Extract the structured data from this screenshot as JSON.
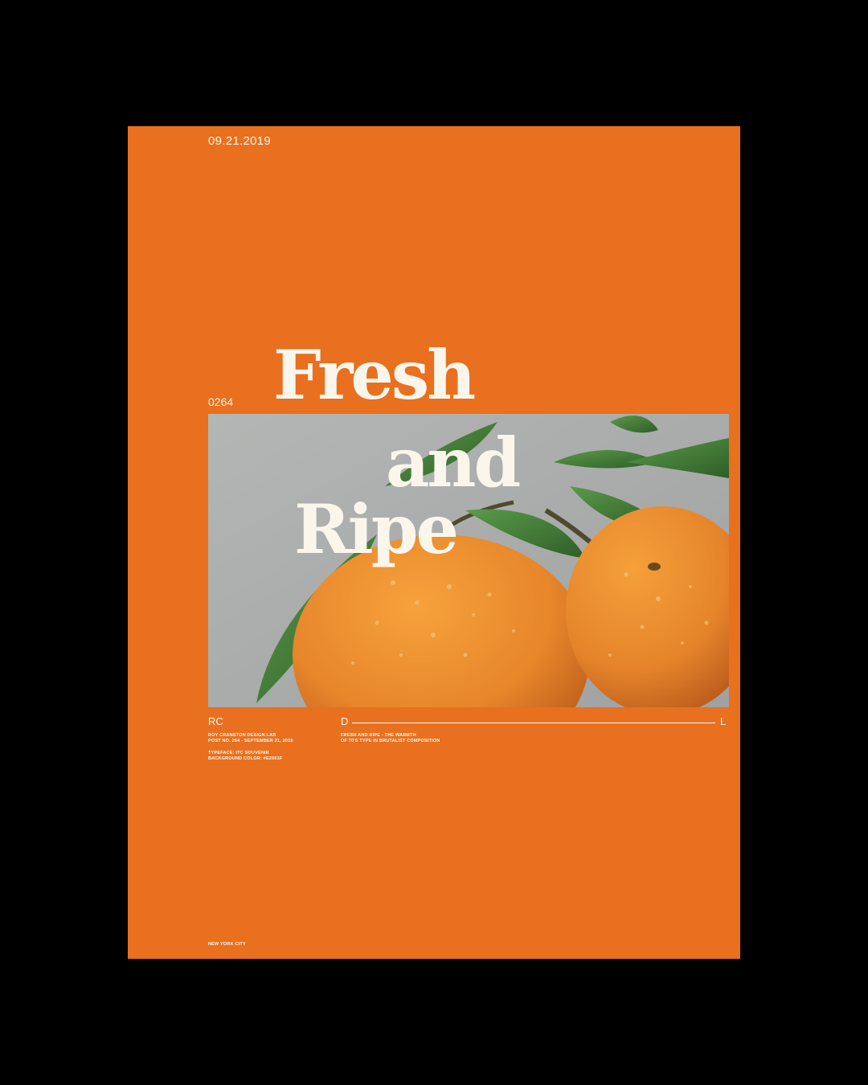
{
  "poster": {
    "date": "09.21.2019",
    "number": "0264",
    "headline": {
      "line1": "Fresh",
      "line2": "and",
      "line3": "Ripe"
    },
    "footer": {
      "initials_left": "RC",
      "initial_mid": "D",
      "initial_right": "L",
      "left_lines_1": [
        "ROY CRANSTON DESIGN LAB",
        "POST NO. 264 - SEPTEMBER 21, 2019"
      ],
      "left_lines_2": [
        "TYPEFACE: ITC SOUVENIR",
        "BACKGROUND COLOR: #E2661F"
      ],
      "right_lines": [
        "FRESH AND RIPE - THE WARMTH",
        "OF 70'S TYPE IN BRUTALIST COMPOSITION"
      ],
      "city": "NEW YORK CITY"
    },
    "colors": {
      "page_background": "#000000",
      "poster_background": "#E8701F",
      "text": "#FFF8EE",
      "photo_background": "#A9ACAA",
      "orange_fruit": "#E7862A",
      "leaf": "#3F7A35"
    },
    "image": "oranges-with-leaves-photo"
  }
}
